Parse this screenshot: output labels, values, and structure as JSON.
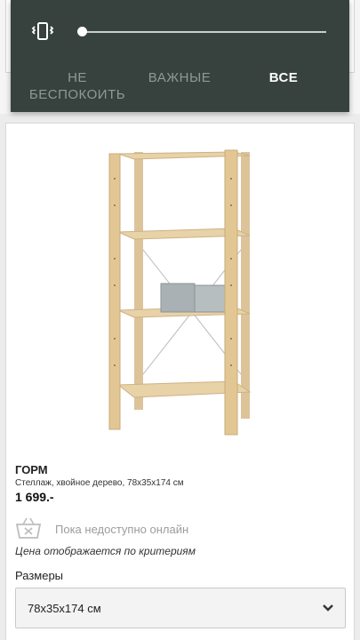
{
  "volume_panel": {
    "icon": "vibrate-icon",
    "level": 0,
    "modes": [
      {
        "label": "НЕ\nБЕСПОКОИТЬ",
        "active": false
      },
      {
        "label": "ВАЖНЫЕ",
        "active": false
      },
      {
        "label": "ВСЕ",
        "active": true
      }
    ],
    "colors": {
      "panel": "#37423f",
      "active_text": "#ffffff",
      "inactive_text": "#8f9896"
    }
  },
  "product": {
    "image": "wooden-shelving-unit",
    "name": "ГОРМ",
    "description": "Стеллаж, хвойное дерево, 78x35x174 см",
    "price": "1 699.-",
    "availability_icon": "basket-unavailable-icon",
    "availability": "Пока недоступно онлайн",
    "price_note": "Цена отображается по критериям",
    "sizes_label": "Размеры",
    "size_selected": "78x35x174 см"
  }
}
